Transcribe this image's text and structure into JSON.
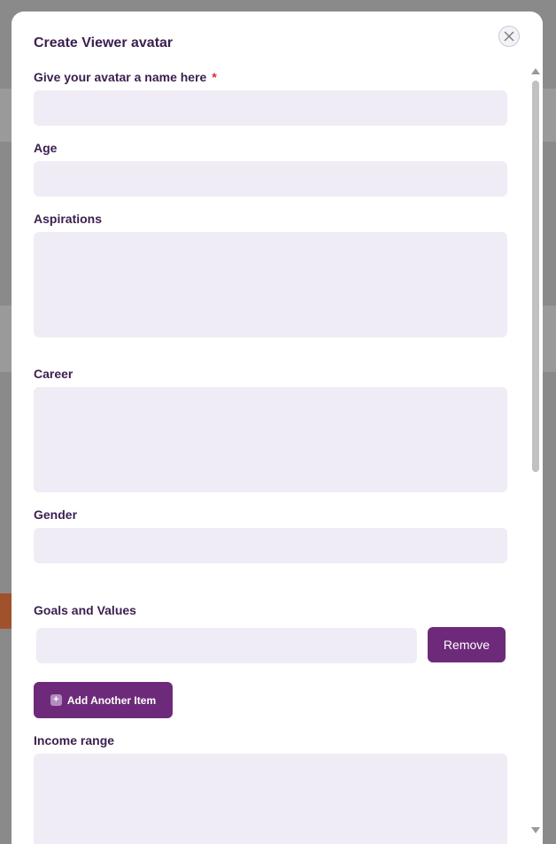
{
  "modal": {
    "title": "Create Viewer avatar",
    "close_icon": "close-icon"
  },
  "form": {
    "name_label": "Give your avatar a name here",
    "required_mark": "*",
    "age_label": "Age",
    "aspirations_label": "Aspirations",
    "career_label": "Career",
    "gender_label": "Gender",
    "goals_label": "Goals and Values",
    "remove_label": "Remove",
    "add_item_label": "Add Another Item",
    "add_item_icon": "plus-icon",
    "income_label": "Income range"
  },
  "values": {
    "name": "",
    "age": "",
    "aspirations": "",
    "career": "",
    "gender": "",
    "goal_item": "",
    "income": ""
  },
  "colors": {
    "accent": "#6e2a7a",
    "field_bg": "#efecf6",
    "label": "#3b1f4f",
    "required": "#e02828",
    "overlay": "#8a8a8a"
  }
}
